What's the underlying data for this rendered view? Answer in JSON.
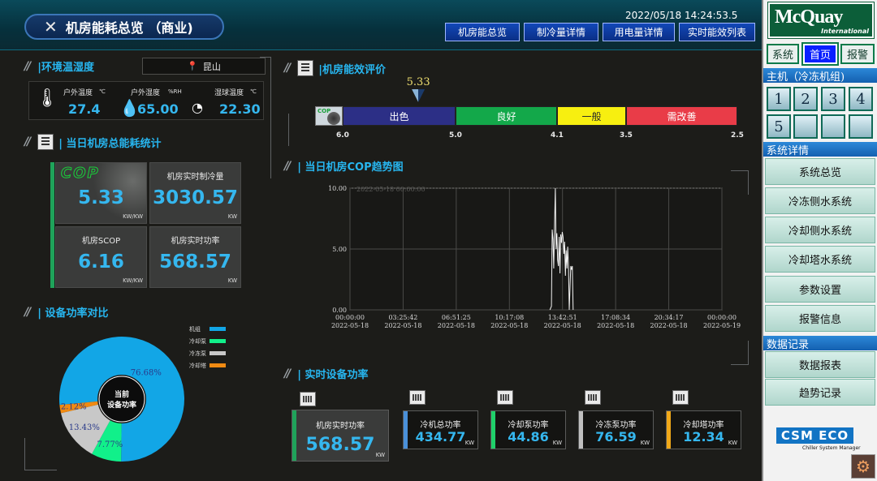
{
  "header": {
    "title": "机房能耗总览 （商业)",
    "datetime": "2022/05/18  14:24:53.5",
    "nav": [
      "机房能总览",
      "制冷量详情",
      "用电量详情",
      "实时能效列表"
    ]
  },
  "environment": {
    "title": "|环境温湿度",
    "location": "昆山",
    "items": [
      {
        "label": "户外温度",
        "unit": "℃",
        "value": "27.4"
      },
      {
        "label": "户外湿度",
        "unit": "%RH",
        "value": "65.00"
      },
      {
        "label": "湿球温度",
        "unit": "℃",
        "value": "22.30"
      }
    ]
  },
  "daily_stats": {
    "title": "| 当日机房总能耗统计",
    "cop_logo": "COP",
    "tiles": [
      {
        "label": "",
        "value": "5.33",
        "unit": "KW/KW"
      },
      {
        "label": "机房实时制冷量",
        "value": "3030.57",
        "unit": "KW"
      },
      {
        "label": "机房SCOP",
        "value": "6.16",
        "unit": "KW/KW"
      },
      {
        "label": "机房实时功率",
        "value": "568.57",
        "unit": "KW"
      }
    ]
  },
  "efficiency": {
    "title": "|机房能效评价",
    "current": "5.33",
    "current_value": 5.33,
    "segments": [
      {
        "label": "出色",
        "color": "#2c2f86",
        "text_color": "#ffffff"
      },
      {
        "label": "良好",
        "color": "#13a84a",
        "text_color": "#ffffff"
      },
      {
        "label": "一般",
        "color": "#f7ef10",
        "text_color": "#2a2a2a"
      },
      {
        "label": "需改善",
        "color": "#e93c48",
        "text_color": "#ffffff"
      }
    ],
    "ticks": [
      "6.0",
      "5.0",
      "4.1",
      "3.5",
      "2.5"
    ]
  },
  "cop_trend": {
    "title": "| 当日机房COP趋势图",
    "chart_data": {
      "type": "line",
      "title": "",
      "annotation": "2022-05-18 00:00:00",
      "x_ticks": [
        {
          "time": "00:00:00",
          "date": "2022-05-18"
        },
        {
          "time": "03:25:42",
          "date": "2022-05-18"
        },
        {
          "time": "06:51:25",
          "date": "2022-05-18"
        },
        {
          "time": "10:17:08",
          "date": "2022-05-18"
        },
        {
          "time": "13:42:51",
          "date": "2022-05-18"
        },
        {
          "time": "17:08:34",
          "date": "2022-05-18"
        },
        {
          "time": "20:34:17",
          "date": "2022-05-18"
        },
        {
          "time": "00:00:00",
          "date": "2022-05-19"
        }
      ],
      "y_ticks": [
        "10.00",
        "5.00",
        "0.00"
      ],
      "ylim": [
        0,
        10
      ],
      "xlim_hours": [
        0,
        24
      ],
      "series": [
        {
          "x_hours": [
            12.9,
            13.0,
            13.05,
            13.1,
            13.15,
            13.2,
            13.25,
            13.3,
            13.35,
            13.4,
            13.45,
            13.5,
            13.55,
            13.6,
            13.65,
            13.7,
            13.75,
            13.8,
            13.85,
            13.9,
            13.95,
            14.0,
            14.05,
            14.1,
            14.15,
            14.25,
            14.3,
            14.35,
            14.4
          ],
          "values": [
            0,
            0.3,
            6.6,
            5.8,
            3.4,
            6.9,
            10.0,
            5.0,
            6.3,
            4.1,
            3.6,
            6.0,
            3.0,
            6.2,
            5.5,
            6.4,
            6.0,
            4.6,
            5.6,
            2.8,
            4.9,
            3.4,
            5.2,
            3.5,
            0,
            3.6,
            3.3,
            3.6,
            0
          ]
        }
      ],
      "grid": true
    }
  },
  "power_ratio": {
    "title": "| 设备功率对比",
    "center_label_1": "当前",
    "center_label_2": "设备功率",
    "chart_data": {
      "type": "pie",
      "labels": [
        "机组",
        "冷却泵",
        "冷冻泵",
        "冷却塔"
      ],
      "values": [
        76.68,
        7.77,
        13.43,
        2.12
      ],
      "display": [
        "76.68%",
        "7.77%",
        "13.43%",
        "2.12%"
      ],
      "colors": [
        "#12a6e6",
        "#11f08a",
        "#c8c8c8",
        "#f08a12"
      ],
      "legend": "top-right"
    }
  },
  "realtime": {
    "title": "| 实时设备功率",
    "boxes": [
      {
        "label": "机房实时功率",
        "value": "568.57",
        "unit": "KW",
        "color": "#1fa35a"
      },
      {
        "label": "冷机总功率",
        "value": "434.77",
        "unit": "KW",
        "color": "#4a90d9"
      },
      {
        "label": "冷却泵功率",
        "value": "44.86",
        "unit": "KW",
        "color": "#1fd06a"
      },
      {
        "label": "冷冻泵功率",
        "value": "76.59",
        "unit": "KW",
        "color": "#c0c0c0"
      },
      {
        "label": "冷却塔功率",
        "value": "12.34",
        "unit": "KW",
        "color": "#f0a818"
      }
    ]
  },
  "sidebar": {
    "logo": "McQuay",
    "logo_sub": "International",
    "tabs": [
      "系统",
      "首页",
      "报警"
    ],
    "host_head": "主机（冷冻机组)",
    "units": [
      "1",
      "2",
      "3",
      "4",
      "5",
      "",
      "",
      ""
    ],
    "details_head": "系统详情",
    "details": [
      "系统总览",
      "冷冻侧水系统",
      "冷却侧水系统",
      "冷却塔水系统",
      "参数设置",
      "报警信息"
    ],
    "records_head": "数据记录",
    "records": [
      "数据报表",
      "趋势记录"
    ],
    "csm": "CSM ECO",
    "csm_sub": "Chiller System Manager",
    "gear": "⚙"
  }
}
